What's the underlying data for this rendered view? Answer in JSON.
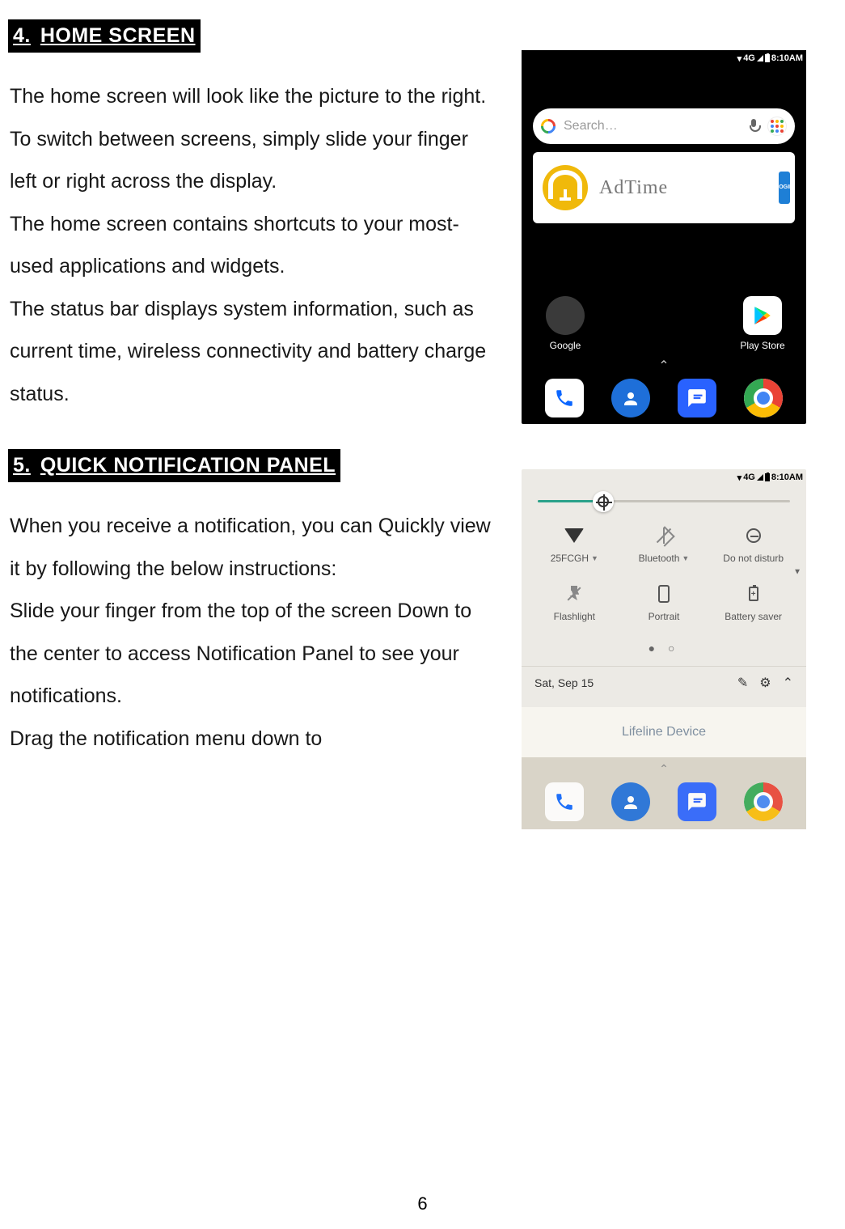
{
  "sections": [
    {
      "num": "4.",
      "title": "HOME SCREEN",
      "body": "The home screen will look like the picture to the right.\nTo switch between screens, simply slide your finger left or right across the display.\nThe home screen contains shortcuts to your most-used applications and widgets.\nThe status bar displays system information, such as current time, wireless connectivity and battery charge status."
    },
    {
      "num": "5.",
      "title": "QUICK NOTIFICATION PANEL",
      "body": "When you receive a notification, you can Quickly view it by following the below instructions:\nSlide your finger from the top of the screen Down to the center to access Notification Panel to see your notifications.\nDrag the notification menu down to"
    }
  ],
  "page_number": "6",
  "phone1": {
    "status": {
      "network": "4G",
      "time": "8:10AM"
    },
    "search_placeholder": "Search…",
    "widget_label": "AdTime",
    "widget_login": "LOGIN",
    "apps": {
      "google": "Google",
      "play": "Play Store"
    },
    "dock": [
      "phone",
      "contacts",
      "messages",
      "chrome"
    ]
  },
  "phone2": {
    "status": {
      "network": "4G",
      "time": "8:10AM"
    },
    "quick_settings": [
      {
        "icon": "wifi",
        "label": "25FCGH",
        "caret": true
      },
      {
        "icon": "bluetooth-off",
        "label": "Bluetooth",
        "caret": true
      },
      {
        "icon": "dnd",
        "label": "Do not disturb",
        "caret": false
      },
      {
        "icon": "flashlight-off",
        "label": "Flashlight",
        "caret": false
      },
      {
        "icon": "portrait",
        "label": "Portrait",
        "caret": false
      },
      {
        "icon": "battery-saver",
        "label": "Battery saver",
        "caret": false
      }
    ],
    "date": "Sat, Sep 15",
    "notification_title": "Lifeline Device"
  }
}
